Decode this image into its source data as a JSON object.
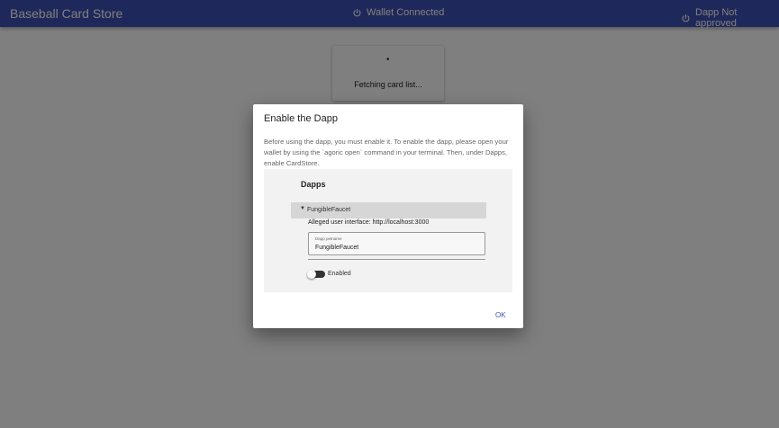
{
  "appbar": {
    "title": "Baseball Card Store",
    "wallet_status": "Wallet Connected",
    "dapp_status": "Dapp Not approved",
    "color": "#3f51b5",
    "wallet_icon": "power-icon",
    "dapp_icon": "power-icon"
  },
  "loading": {
    "message": "Fetching card list..."
  },
  "dialog": {
    "title": "Enable the Dapp",
    "body": "Before using the dapp, you must enable it. To enable the dapp, please open your wallet by using the `agoric open` command in your terminal. Then, under Dapps, enable CardStore.",
    "ok_label": "OK"
  },
  "wallet_screenshot": {
    "heading": "Dapps",
    "dapp_name": "FungibleFaucet",
    "alleged_ui": "Alleged user interface: http://localhost:3000",
    "petname_label": "Dapp petname",
    "petname_value": "FungibleFaucet",
    "toggle_label": "Enabled",
    "toggle_enabled": false
  }
}
